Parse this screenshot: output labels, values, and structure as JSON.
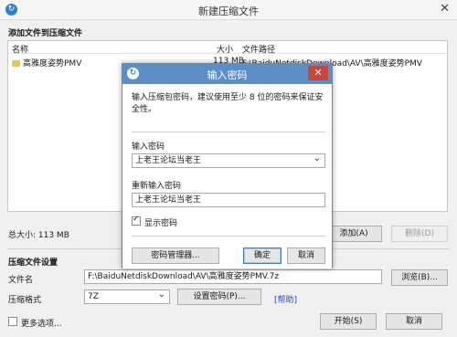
{
  "window": {
    "title": "新建压缩文件"
  },
  "add_section": {
    "title": "添加文件到压缩文件",
    "columns": {
      "name": "名称",
      "size": "大小",
      "path": "文件路径"
    },
    "rows": [
      {
        "name": "高雅度姿势PMV",
        "size": "113 MB",
        "path": "F:\\BaiduNetdiskDownload\\AV\\高雅度姿势PMV"
      }
    ],
    "total": "总大小: 113 MB",
    "add_button": "添加(A)",
    "delete_button": "删除(D)"
  },
  "settings": {
    "title": "压缩文件设置",
    "filename_label": "文件名",
    "filename_value": "F:\\BaiduNetdiskDownload\\AV\\高雅度姿势PMV.7z",
    "browse_button": "浏览(B)...",
    "format_label": "压缩格式",
    "format_value": "7Z",
    "set_password_button": "设置密码(P)...",
    "help_link": "[帮助]"
  },
  "footer": {
    "more_options": "更多选项...",
    "start_button": "开始(S)",
    "cancel_button": "取消"
  },
  "dialog": {
    "title": "输入密码",
    "hint": "输入压缩包密码，建议使用至少 8 位的密码来保证安全性。",
    "password_label": "输入密码",
    "password_value": "上老王论坛当老王",
    "reenter_label": "重新输入密码",
    "reenter_value": "上老王论坛当老王",
    "show_password": "显示密码",
    "show_password_checked": true,
    "manager_button": "密码管理器...",
    "ok_button": "确定",
    "cancel_button": "取消"
  }
}
